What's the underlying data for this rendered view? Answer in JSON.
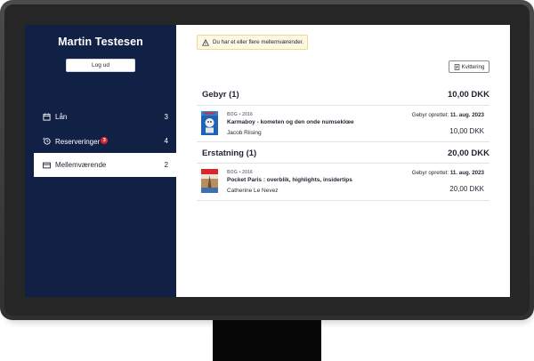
{
  "sidebar": {
    "user_name": "Martin Testesen",
    "logout_label": "Log ud",
    "nav": [
      {
        "label": "Lån",
        "count": "3",
        "icon": "calendar-icon"
      },
      {
        "label": "Reserveringer",
        "count": "4",
        "badge": "3",
        "icon": "reservation-icon"
      },
      {
        "label": "Mellemværende",
        "count": "2",
        "icon": "card-icon",
        "active": true
      }
    ]
  },
  "main": {
    "alert_text": "Du har et eller flere mellemværender.",
    "receipt_label": "Kvittering",
    "sections": [
      {
        "title": "Gebyr (1)",
        "total": "10,00 DKK",
        "items": [
          {
            "meta": "BOG • 2016",
            "title": "Karmaboy - kometen og den onde numseklœe",
            "author": "Jacob Riising",
            "date_label": "Gebyr oprettet:",
            "date": "11. aug. 2023",
            "amount": "10,00 DKK"
          }
        ]
      },
      {
        "title": "Erstatning (1)",
        "total": "20,00 DKK",
        "items": [
          {
            "meta": "BOG • 2016",
            "title": "Pocket Paris : overblik, highlights, insidertips",
            "author": "Catherine Le Nevez",
            "date_label": "Gebyr oprettet:",
            "date": "11. aug. 2023",
            "amount": "20,00 DKK"
          }
        ]
      }
    ]
  },
  "colors": {
    "sidebar_bg": "#112145",
    "badge": "#d9262e",
    "alert_bg": "#fdf8e4",
    "alert_border": "#f1d98c"
  }
}
